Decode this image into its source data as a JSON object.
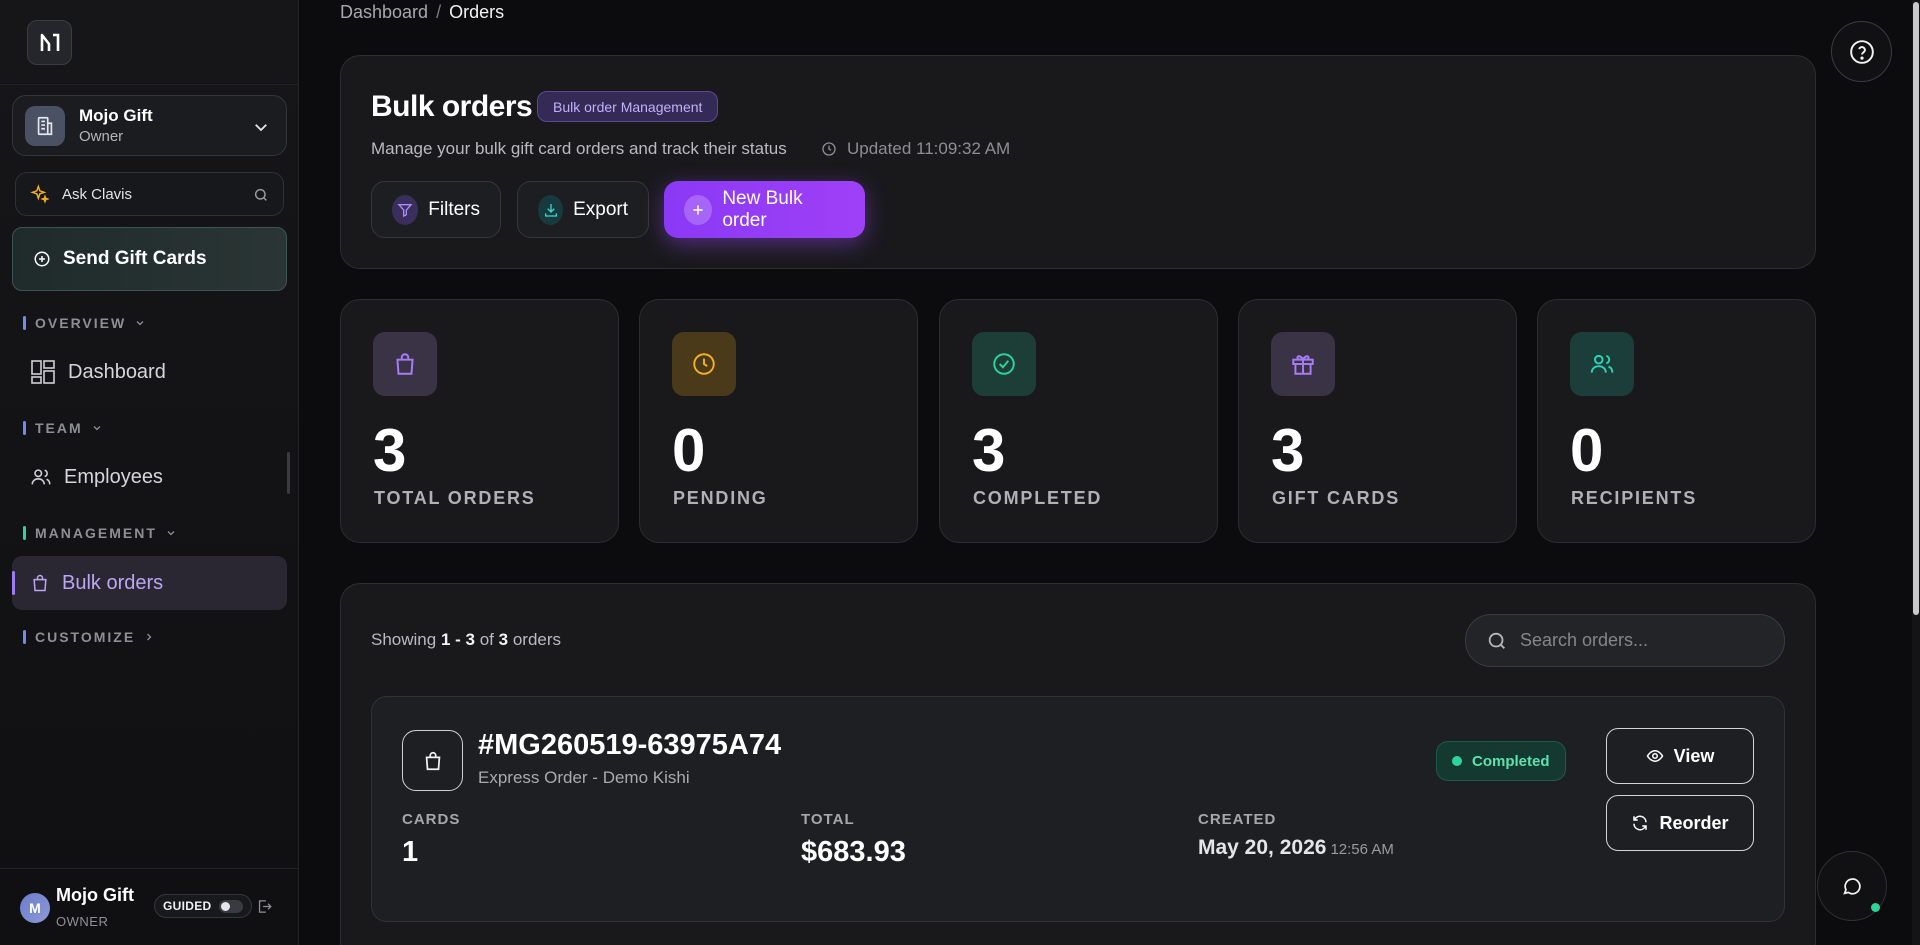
{
  "sidebar": {
    "workspace": {
      "name": "Mojo Gift",
      "role": "Owner"
    },
    "ask": {
      "label": "Ask Clavis"
    },
    "send_button": "Send Gift Cards",
    "sections": [
      {
        "title": "OVERVIEW",
        "color": "#6d8ef0"
      },
      {
        "title": "TEAM",
        "color": "#6d8ef0"
      },
      {
        "title": "MANAGEMENT",
        "color": "#2fd39a"
      },
      {
        "title": "CUSTOMIZE",
        "color": "#6d8ef0"
      }
    ],
    "items": [
      {
        "label": "Dashboard",
        "icon": "dashboard-icon"
      },
      {
        "label": "Employees",
        "icon": "users-icon"
      },
      {
        "label": "Bulk orders",
        "icon": "shopping-bag-icon",
        "active": true
      }
    ],
    "user": {
      "initial": "M",
      "name": "Mojo Gift",
      "role": "OWNER",
      "guided_label": "GUIDED",
      "guided_on": false
    }
  },
  "breadcrumb": {
    "root": "Dashboard",
    "separator": "/",
    "current": "Orders"
  },
  "hero": {
    "title": "Bulk orders",
    "tag": "Bulk order Management",
    "subtitle": "Manage your bulk gift card orders and track their status",
    "updated": "Updated 11:09:32 AM",
    "buttons": {
      "filters": "Filters",
      "export": "Export",
      "new": "New Bulk order"
    }
  },
  "stats": [
    {
      "value": "3",
      "label": "TOTAL ORDERS",
      "icon": "shopping-bag-icon",
      "color": "#a87cf5"
    },
    {
      "value": "0",
      "label": "PENDING",
      "icon": "clock-icon",
      "color": "#f2b01e"
    },
    {
      "value": "3",
      "label": "COMPLETED",
      "icon": "check-circle-icon",
      "color": "#2fd39a"
    },
    {
      "value": "3",
      "label": "GIFT CARDS",
      "icon": "gift-icon",
      "color": "#a87cf5"
    },
    {
      "value": "0",
      "label": "RECIPIENTS",
      "icon": "users-icon",
      "color": "#2fd3b6"
    }
  ],
  "orders": {
    "showing_prefix": "Showing",
    "range": "1 - 3",
    "of": "of",
    "total": "3",
    "suffix": "orders",
    "search_placeholder": "Search orders...",
    "list": [
      {
        "id": "#MG260519-63975A74",
        "subtitle": "Express Order - Demo Kishi",
        "status": "Completed",
        "cards_label": "CARDS",
        "cards": "1",
        "total_label": "TOTAL",
        "total": "$683.93",
        "created_label": "CREATED",
        "created_date": "May 20, 2026",
        "created_time": "12:56 AM",
        "view_label": "View",
        "reorder_label": "Reorder"
      }
    ]
  }
}
